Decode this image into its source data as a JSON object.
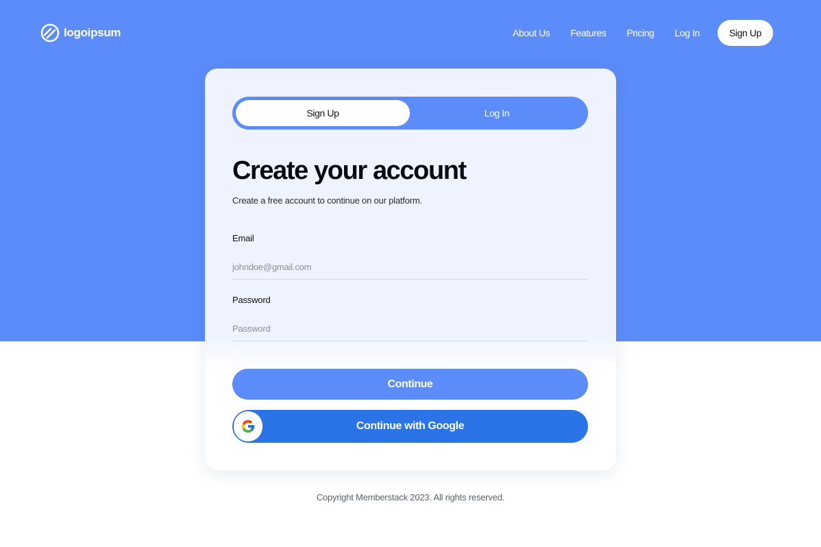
{
  "navbar": {
    "logo_text": "logoipsum",
    "links": [
      "About Us",
      "Features",
      "Pricing",
      "Log In"
    ],
    "cta_label": "Sign Up"
  },
  "auth_card": {
    "tabs": {
      "signup_label": "Sign Up",
      "login_label": "Log In",
      "active": "Sign Up"
    },
    "title": "Create your account",
    "subtitle": "Create a free account to continue on our platform.",
    "email": {
      "label": "Email",
      "placeholder": "johndoe@gmail.com",
      "value": ""
    },
    "password": {
      "label": "Password",
      "placeholder": "Password",
      "value": ""
    },
    "continue_label": "Continue",
    "google_label": "Continue with Google"
  },
  "footer": {
    "copyright": "Copyright Memberstack 2023. All rights reserved."
  },
  "colors": {
    "hero_blue": "#5b8cfa",
    "google_button_blue": "#2a74e8",
    "card_background": "#eef3ff"
  },
  "icons": {
    "logo": "logoipsum-mark-icon",
    "google": "google-g-icon"
  }
}
